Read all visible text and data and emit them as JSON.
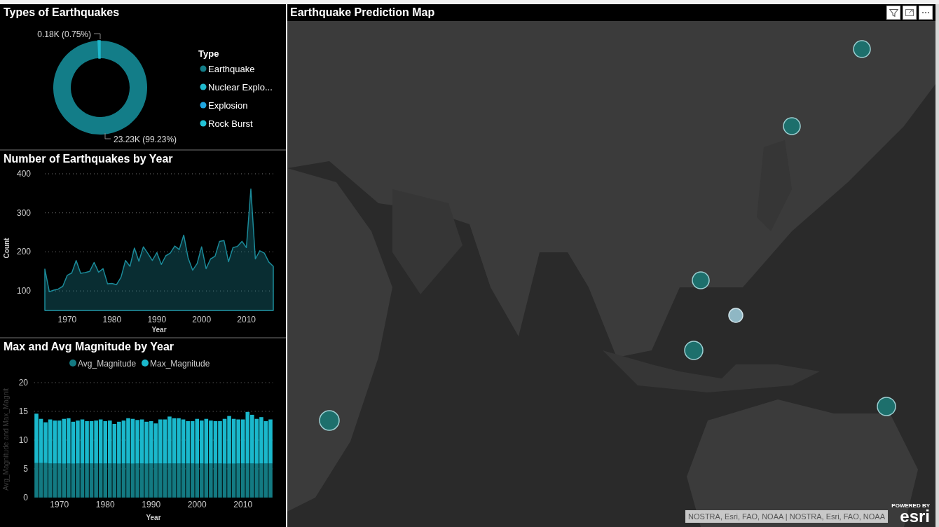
{
  "panels": [
    {
      "title": "Types of Earthquakes",
      "chart_data": {
        "type": "donut",
        "legend": {
          "title": "Type"
        },
        "categories": [
          "Earthquake",
          "Nuclear Explo...",
          "Explosion",
          "Rock Burst"
        ],
        "colors": [
          "#137d88",
          "#1fb8cc",
          "#1fa6e0",
          "#22c3d6"
        ],
        "values": [
          23230,
          176,
          null,
          null
        ],
        "value_labels": [
          "23.23K (99.23%)",
          "0.18K (0.75%)",
          null,
          null
        ]
      }
    },
    {
      "title": "Number of Earthquakes by Year",
      "chart_data": {
        "type": "area",
        "xlabel": "Year",
        "ylabel": "Count",
        "xlim": [
          1965,
          2016
        ],
        "ylim": [
          50,
          400
        ],
        "xticks": [
          1970,
          1980,
          1990,
          2000,
          2010
        ],
        "yticks": [
          100,
          200,
          300,
          400
        ],
        "grid": true,
        "x": [
          1965,
          1966,
          1967,
          1968,
          1969,
          1970,
          1971,
          1972,
          1973,
          1974,
          1975,
          1976,
          1977,
          1978,
          1979,
          1980,
          1981,
          1982,
          1983,
          1984,
          1985,
          1986,
          1987,
          1988,
          1989,
          1990,
          1991,
          1992,
          1993,
          1994,
          1995,
          1996,
          1997,
          1998,
          1999,
          2000,
          2001,
          2002,
          2003,
          2004,
          2005,
          2006,
          2007,
          2008,
          2009,
          2010,
          2011,
          2012,
          2013,
          2014,
          2015,
          2016
        ],
        "series": [
          {
            "color": "#1b8a99",
            "values": [
              156,
              98,
              102,
              105,
              112,
              140,
              146,
              178,
              145,
              147,
              150,
              173,
              148,
              157,
              118,
              119,
              116,
              135,
              178,
              163,
              210,
              176,
              213,
              196,
              178,
              198,
              168,
              190,
              197,
              215,
              206,
              243,
              184,
              153,
              170,
              213,
              157,
              182,
              189,
              227,
              229,
              175,
              211,
              214,
              227,
              211,
              361,
              182,
              203,
              197,
              174,
              163
            ]
          }
        ]
      }
    },
    {
      "title": "Max and Avg Magnitude by Year",
      "chart_data": {
        "type": "bar",
        "xlabel": "Year",
        "ylabel": "Avg_Magnitude and Max_Magnit",
        "xlim": [
          1964.5,
          2016.5
        ],
        "ylim": [
          0,
          20
        ],
        "xticks": [
          1970,
          1980,
          1990,
          2000,
          2010
        ],
        "yticks": [
          0,
          5,
          10,
          15,
          20
        ],
        "stacked": true,
        "grid": true,
        "legend": true,
        "x": [
          1965,
          1966,
          1967,
          1968,
          1969,
          1970,
          1971,
          1972,
          1973,
          1974,
          1975,
          1976,
          1977,
          1978,
          1979,
          1980,
          1981,
          1982,
          1983,
          1984,
          1985,
          1986,
          1987,
          1988,
          1989,
          1990,
          1991,
          1992,
          1993,
          1994,
          1995,
          1996,
          1997,
          1998,
          1999,
          2000,
          2001,
          2002,
          2003,
          2004,
          2005,
          2006,
          2007,
          2008,
          2009,
          2010,
          2011,
          2012,
          2013,
          2014,
          2015,
          2016
        ],
        "series": [
          {
            "name": "Avg_Magnitude",
            "color": "#137a82",
            "values": [
              6.0,
              6.0,
              6.0,
              5.9,
              5.9,
              5.9,
              5.9,
              5.9,
              5.9,
              5.9,
              5.9,
              5.9,
              5.9,
              5.9,
              5.9,
              5.9,
              5.9,
              5.9,
              5.9,
              5.9,
              5.9,
              5.9,
              5.9,
              5.9,
              5.9,
              5.9,
              5.9,
              5.9,
              5.9,
              5.9,
              5.9,
              5.9,
              5.9,
              5.9,
              5.9,
              5.9,
              5.9,
              5.9,
              5.9,
              5.9,
              5.9,
              5.9,
              5.9,
              5.9,
              5.9,
              5.9,
              5.9,
              5.9,
              5.9,
              5.9,
              5.9,
              5.9
            ]
          },
          {
            "name": "Max_Magnitude",
            "color": "#1ab8cc",
            "values": [
              8.6,
              7.7,
              7.1,
              7.7,
              7.5,
              7.5,
              7.8,
              7.9,
              7.3,
              7.5,
              7.7,
              7.4,
              7.4,
              7.5,
              7.7,
              7.4,
              7.5,
              6.9,
              7.3,
              7.5,
              7.9,
              7.8,
              7.6,
              7.7,
              7.3,
              7.4,
              7.0,
              7.7,
              7.7,
              8.2,
              7.9,
              7.9,
              7.7,
              7.4,
              7.4,
              7.8,
              7.5,
              7.8,
              7.5,
              7.4,
              7.4,
              7.8,
              8.3,
              7.8,
              7.7,
              7.7,
              9.0,
              8.5,
              7.8,
              8.1,
              7.4,
              7.7
            ]
          }
        ]
      }
    }
  ],
  "map": {
    "title": "Earthquake Prediction Map",
    "buttons": [
      {
        "kind": "filter"
      },
      {
        "kind": "focus"
      },
      {
        "kind": "more"
      }
    ],
    "attribution": "NOSTRA, Esri, FAO, NOAA | NOSTRA, Esri, FAO, NOAA",
    "logo": {
      "tagline": "POWERED BY",
      "name": "esri"
    }
  }
}
